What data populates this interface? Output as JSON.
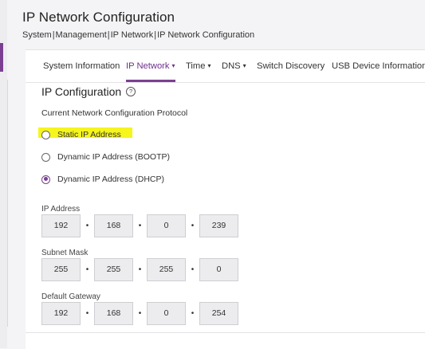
{
  "header": {
    "title": "IP Network Configuration",
    "breadcrumb": [
      "System",
      "Management",
      "IP Network",
      "IP Network Configuration"
    ]
  },
  "tabs": [
    {
      "label": "System Information",
      "dropdown": false,
      "active": false
    },
    {
      "label": "IP Network",
      "dropdown": true,
      "active": true
    },
    {
      "label": "Time",
      "dropdown": true,
      "active": false
    },
    {
      "label": "DNS",
      "dropdown": true,
      "active": false
    },
    {
      "label": "Switch Discovery",
      "dropdown": false,
      "active": false
    },
    {
      "label": "USB Device Information",
      "dropdown": false,
      "active": false
    }
  ],
  "section": {
    "title": "IP Configuration",
    "help_icon": "?",
    "protocol_label": "Current Network Configuration Protocol"
  },
  "protocol_options": [
    {
      "label": "Static IP Address",
      "selected": false,
      "highlighted": true
    },
    {
      "label": "Dynamic IP Address (BOOTP)",
      "selected": false,
      "highlighted": false
    },
    {
      "label": "Dynamic IP Address (DHCP)",
      "selected": true,
      "highlighted": false
    }
  ],
  "fields": {
    "ip_address": {
      "label": "IP Address",
      "octets": [
        "192",
        "168",
        "0",
        "239"
      ]
    },
    "subnet_mask": {
      "label": "Subnet Mask",
      "octets": [
        "255",
        "255",
        "255",
        "0"
      ]
    },
    "default_gateway": {
      "label": "Default Gateway",
      "octets": [
        "192",
        "168",
        "0",
        "254"
      ]
    }
  },
  "separator_glyph": "•",
  "caret_glyph": "▾",
  "colors": {
    "accent": "#7b3f91",
    "highlight": "#f6f51e",
    "field_bg": "#ececee"
  }
}
